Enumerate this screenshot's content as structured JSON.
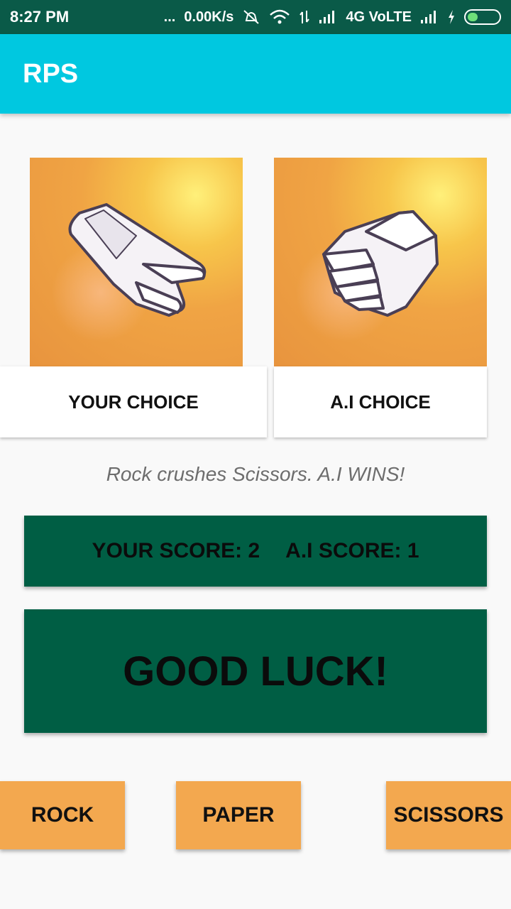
{
  "status_bar": {
    "time": "8:27 PM",
    "dots": "...",
    "net_speed": "0.00K/s",
    "network": "4G VoLTE",
    "icons": [
      "mute-icon",
      "wifi-icon",
      "data-arrows-icon",
      "signal-icon",
      "signal-icon",
      "charging-icon",
      "battery-icon"
    ]
  },
  "app_bar": {
    "title": "RPS"
  },
  "choices": {
    "user_label": "YOUR CHOICE",
    "ai_label": "A.I CHOICE",
    "user_icon": "scissors-hand-icon",
    "ai_icon": "rock-fist-icon"
  },
  "result": {
    "message": "Rock crushes Scissors. A.I WINS!"
  },
  "score": {
    "user": "YOUR SCORE: 2",
    "ai": "A.I SCORE: 1"
  },
  "banner": {
    "text": "GOOD LUCK!"
  },
  "buttons": {
    "rock": "ROCK",
    "paper": "PAPER",
    "scissors": "SCISSORS"
  },
  "colors": {
    "status_bar": "#0a5a48",
    "app_bar": "#00c8e0",
    "panel": "#005e44",
    "button": "#f3a84f",
    "background": "#f9f9f9"
  }
}
